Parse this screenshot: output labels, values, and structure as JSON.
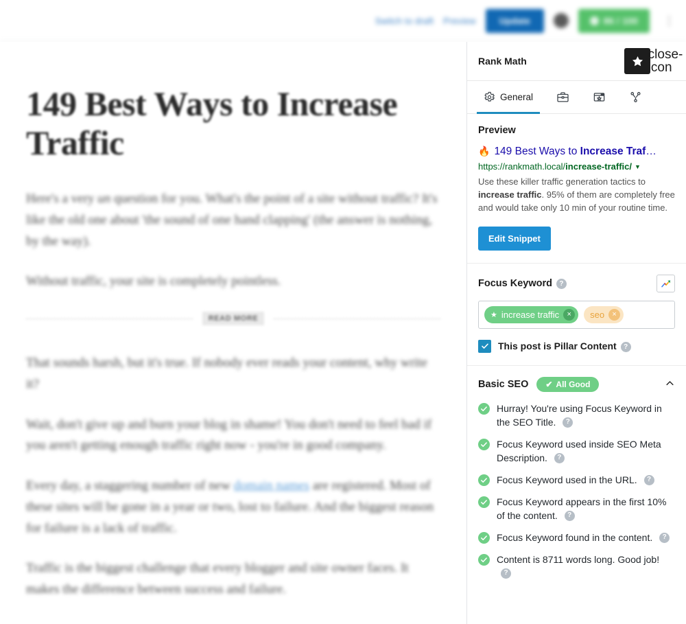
{
  "toolbar": {
    "switch_to_draft": "Switch to draft",
    "preview": "Preview",
    "update": "Update",
    "settings_icon": "gear-icon",
    "seo_score": "86 / 100",
    "kebab": "⋮"
  },
  "editor": {
    "title": "149 Best Ways to Increase Traffic",
    "read_more_label": "READ MORE",
    "paragraphs": [
      "Here's a very <em>un</em> question for you. What's the point of a site without traffic? It's like the old one about 'the sound of one hand clapping' (the answer is nothing, by the way).",
      "Without traffic, your site is completely pointless.",
      "That sounds harsh, but it's true. If nobody ever reads your content, why write it?",
      "Wait, don't give up and burn your blog in shame! You don't need to feel bad if you aren't getting enough traffic right now - you're in good company.",
      "Every day, a staggering number of new domain names are registered. Most of these sites will be gone in a year or two, lost to failure. And the biggest reason for failure is a lack of traffic.",
      "Traffic is the biggest challenge that every blogger and site owner faces. It makes the difference between success and failure."
    ],
    "link_text": "domain names"
  },
  "panel": {
    "title": "Rank Math",
    "star_icon": "star-icon",
    "close_icon": "close-icon",
    "tabs": [
      {
        "label": "General",
        "icon": "gear-icon",
        "active": true
      },
      {
        "label": "",
        "icon": "briefcase-icon",
        "active": false
      },
      {
        "label": "",
        "icon": "schema-browser-star-icon",
        "active": false
      },
      {
        "label": "",
        "icon": "social-share-icon",
        "active": false
      }
    ],
    "preview": {
      "heading": "Preview",
      "flame_icon": "fire-emoji",
      "title_plain": "149 Best Ways to ",
      "title_bold": "Increase Traf",
      "title_ellipsis": "…",
      "url_domain": "https://rankmath.local/",
      "url_slug": "increase-traffic/",
      "url_caret": "▼",
      "description_part1": "Use these killer traffic generation tactics to ",
      "description_bold": "increase traffic",
      "description_part2": ". 95% of them are completely free and would take only 10 min of your routine time.",
      "edit_button": "Edit Snippet"
    },
    "focus_keyword": {
      "heading": "Focus Keyword",
      "help": "?",
      "trends_icon": "google-trends-icon",
      "keywords": [
        {
          "label": "increase traffic",
          "type": "primary",
          "star": "★",
          "remove": "×"
        },
        {
          "label": "seo",
          "type": "secondary",
          "star": "",
          "remove": "×"
        }
      ],
      "pillar_label": "This post is Pillar Content",
      "pillar_checked": true,
      "pillar_check_glyph": "✓"
    },
    "basic_seo": {
      "heading": "Basic SEO",
      "badge": "All Good",
      "badge_check": "✔",
      "collapse_icon": "chevron-up-icon",
      "checks": [
        {
          "status": "good",
          "text": "Hurray! You're using Focus Keyword in the SEO Title.",
          "help": "?"
        },
        {
          "status": "good",
          "text": "Focus Keyword used inside SEO Meta Description.",
          "help": "?"
        },
        {
          "status": "good",
          "text": "Focus Keyword used in the URL.",
          "help": "?"
        },
        {
          "status": "good",
          "text": "Focus Keyword appears in the first 10% of the content.",
          "help": "?"
        },
        {
          "status": "good",
          "text": "Focus Keyword found in the content.",
          "help": "?"
        },
        {
          "status": "good",
          "text": "Content is 8711 words long. Good job!",
          "help": "?"
        }
      ]
    }
  },
  "colors": {
    "accent_blue": "#1e8cbe",
    "update_blue": "#1168b3",
    "good_green": "#6fcf86",
    "snippet_title_blue": "#1a0dab",
    "snippet_url_green": "#006621",
    "secondary_keyword": "#e8a33d"
  }
}
